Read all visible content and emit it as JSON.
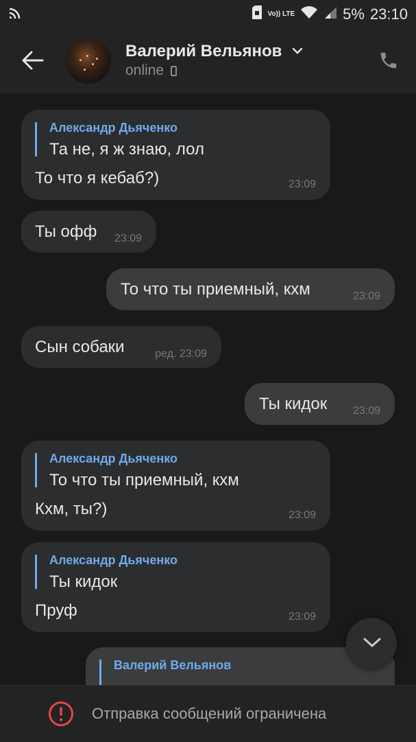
{
  "status_bar": {
    "battery": "5%",
    "time": "23:10",
    "network": "Vo)) LTE"
  },
  "header": {
    "contact_name": "Валерий Вельянов",
    "status": "online"
  },
  "messages": [
    {
      "reply_author": "Александр Дьяченко",
      "reply_text": "Та не, я ж знаю, лол",
      "text": "То что я кебаб?)",
      "time": "23:09"
    },
    {
      "text": "Ты офф",
      "time": "23:09"
    },
    {
      "text": "То что ты приемный, кхм",
      "time": "23:09"
    },
    {
      "text": "Сын собаки",
      "time": "ред. 23:09"
    },
    {
      "text": "Ты кидок",
      "time": "23:09"
    },
    {
      "reply_author": "Александр Дьяченко",
      "reply_text": "То что ты приемный, кхм",
      "text": "Кхм, ты?)",
      "time": "23:09"
    },
    {
      "reply_author": "Александр Дьяченко",
      "reply_text": "Ты кидок",
      "text": "Пруф",
      "time": "23:09"
    },
    {
      "reply_author": "Валерий Вельянов"
    }
  ],
  "footer": {
    "notice": "Отправка сообщений ограничена"
  },
  "icons": {
    "back": "arrow-left-icon",
    "call": "phone-icon",
    "scroll": "chevron-down-icon",
    "warning": "exclamation-circle-icon"
  },
  "colors": {
    "accent": "#71aaeb",
    "warning": "#e64646",
    "bubble_in": "#2c2d2e",
    "bubble_out": "#3b3c3e"
  }
}
